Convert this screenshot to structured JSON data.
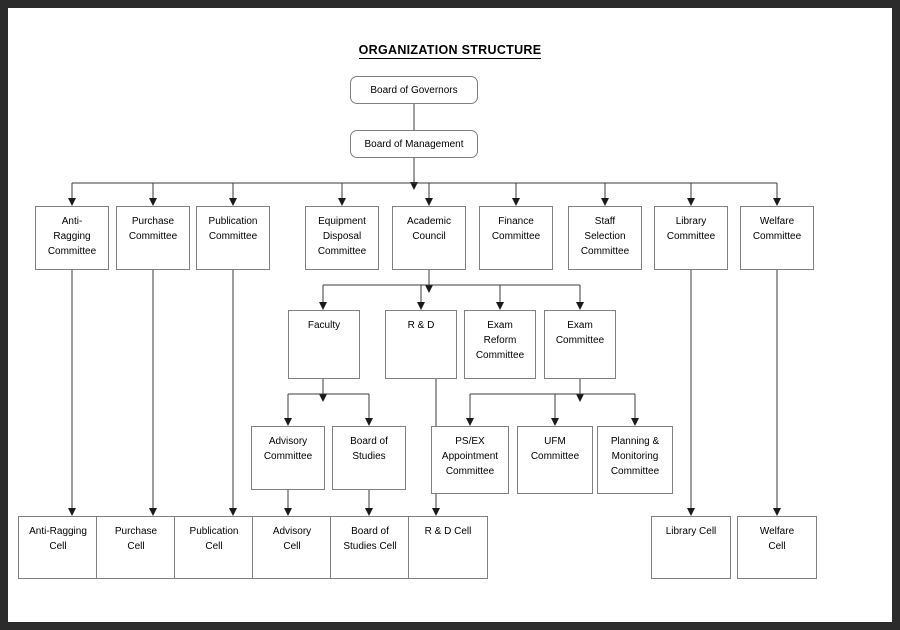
{
  "title": "ORGANIZATION  STRUCTURE",
  "chart_data": {
    "type": "diagram",
    "diagram_kind": "organization-chart",
    "title": "ORGANIZATION  STRUCTURE",
    "orientation": "top-down",
    "levels": [
      {
        "level": 1,
        "nodes": [
          "Board of Governors"
        ]
      },
      {
        "level": 2,
        "nodes": [
          "Board of Management"
        ]
      },
      {
        "level": 3,
        "nodes": [
          "Anti-Ragging Committee",
          "Purchase Committee",
          "Publication Committee",
          "Equipment Disposal Committee",
          "Academic Council",
          "Finance Committee",
          "Staff Selection Committee",
          "Library Committee",
          "Welfare Committee"
        ]
      },
      {
        "level": 4,
        "nodes": [
          "Faculty",
          "R & D",
          "Exam Reform Committee",
          "Exam Committee"
        ]
      },
      {
        "level": 5,
        "nodes": [
          "Advisory Committee",
          "Board of Studies",
          "PS/EX Appointment Committee",
          "UFM Committee",
          "Planning & Monitoring Committee"
        ]
      },
      {
        "level": 6,
        "nodes": [
          "Anti-Ragging Cell",
          "Purchase Cell",
          "Publication Cell",
          "Advisory Cell",
          "Board of Studies Cell",
          "R & D Cell",
          "Library Cell",
          "Welfare Cell"
        ]
      }
    ],
    "edges": [
      {
        "from": "Board of Governors",
        "to": "Board of Management"
      },
      {
        "from": "Board of Management",
        "to": "Anti-Ragging Committee"
      },
      {
        "from": "Board of Management",
        "to": "Purchase Committee"
      },
      {
        "from": "Board of Management",
        "to": "Publication Committee"
      },
      {
        "from": "Board of Management",
        "to": "Equipment Disposal Committee"
      },
      {
        "from": "Board of Management",
        "to": "Academic Council"
      },
      {
        "from": "Board of Management",
        "to": "Finance Committee"
      },
      {
        "from": "Board of Management",
        "to": "Staff Selection Committee"
      },
      {
        "from": "Board of Management",
        "to": "Library Committee"
      },
      {
        "from": "Board of Management",
        "to": "Welfare Committee"
      },
      {
        "from": "Academic Council",
        "to": "Faculty"
      },
      {
        "from": "Academic Council",
        "to": "R & D"
      },
      {
        "from": "Academic Council",
        "to": "Exam Reform Committee"
      },
      {
        "from": "Academic Council",
        "to": "Exam Committee"
      },
      {
        "from": "Faculty",
        "to": "Advisory Committee"
      },
      {
        "from": "Faculty",
        "to": "Board of Studies"
      },
      {
        "from": "Exam Committee",
        "to": "PS/EX Appointment Committee"
      },
      {
        "from": "Exam Committee",
        "to": "UFM Committee"
      },
      {
        "from": "Exam Committee",
        "to": "Planning & Monitoring Committee"
      },
      {
        "from": "Anti-Ragging Committee",
        "to": "Anti-Ragging Cell"
      },
      {
        "from": "Purchase Committee",
        "to": "Purchase Cell"
      },
      {
        "from": "Publication Committee",
        "to": "Publication Cell"
      },
      {
        "from": "Advisory Committee",
        "to": "Advisory Cell"
      },
      {
        "from": "Board of Studies",
        "to": "Board of Studies Cell"
      },
      {
        "from": "R & D",
        "to": "R & D Cell"
      },
      {
        "from": "Library Committee",
        "to": "Library Cell"
      },
      {
        "from": "Welfare Committee",
        "to": "Welfare Cell"
      }
    ],
    "colors": {
      "page_background": "#ffffff",
      "outer_border": "#2b2b2b",
      "node_border": "#808080",
      "node_fill": "#ffffff",
      "connector": "#3b3b3b",
      "text": "#000000"
    }
  },
  "nodes": {
    "board_of_governors": "Board of Governors",
    "board_of_management": "Board of Management",
    "anti_ragging_committee": "Anti-\nRagging\nCommittee",
    "purchase_committee": "Purchase\nCommittee",
    "publication_committee": "Publication\nCommittee",
    "equipment_disposal_committee": "Equipment\nDisposal\nCommittee",
    "academic_council": "Academic\nCouncil",
    "finance_committee": "Finance\nCommittee",
    "staff_selection_committee": "Staff\nSelection\nCommittee",
    "library_committee": "Library\nCommittee",
    "welfare_committee": "Welfare\nCommittee",
    "faculty": "Faculty",
    "rnd": "R & D",
    "exam_reform_committee": "Exam\nReform\nCommittee",
    "exam_committee": "Exam\nCommittee",
    "advisory_committee": "Advisory\nCommittee",
    "board_of_studies": "Board of\nStudies",
    "psex_appointment_committee": "PS/EX\nAppointment\nCommittee",
    "ufm_committee": "UFM\nCommittee",
    "planning_monitoring_committee": "Planning &\nMonitoring\nCommittee",
    "anti_ragging_cell": "Anti-Ragging\nCell",
    "purchase_cell": "Purchase\nCell",
    "publication_cell": "Publication\nCell",
    "advisory_cell": "Advisory\nCell",
    "board_of_studies_cell": "Board of\nStudies Cell",
    "rnd_cell": "R & D Cell",
    "library_cell": "Library Cell",
    "welfare_cell": "Welfare\nCell"
  }
}
